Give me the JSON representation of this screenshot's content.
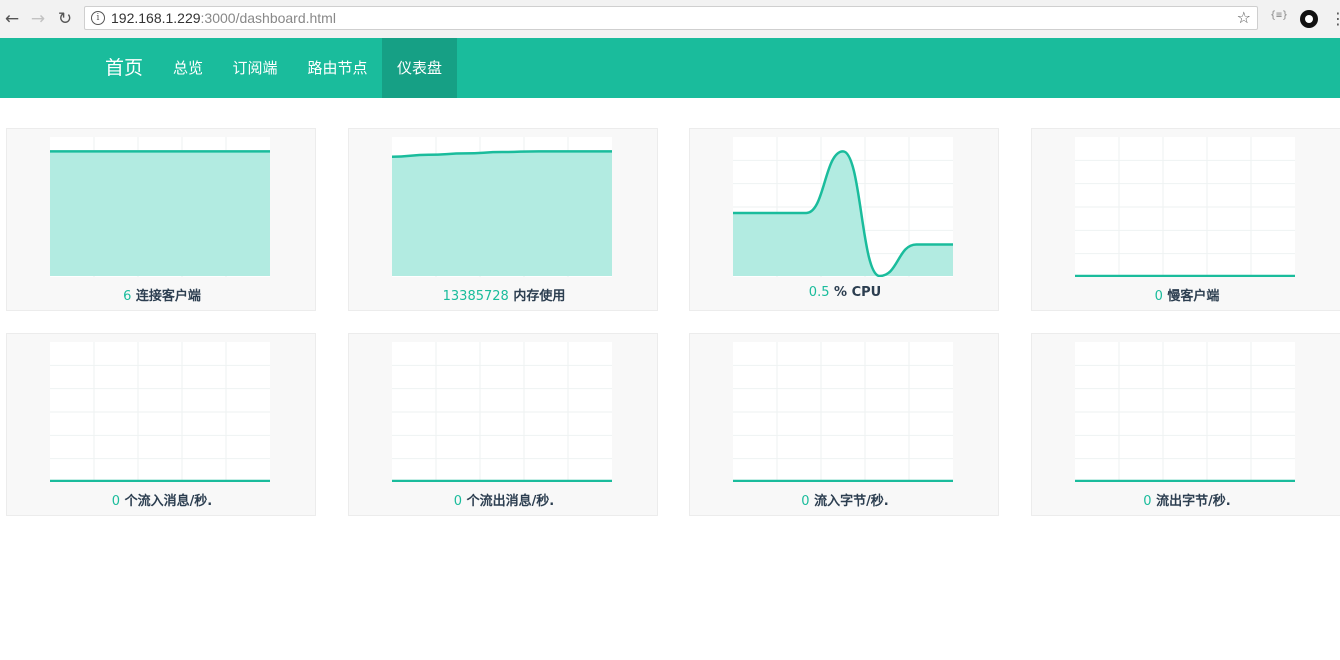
{
  "browser": {
    "url_host": "192.168.1.229",
    "url_rest": ":3000/dashboard.html"
  },
  "navbar": {
    "brand": "首页",
    "items": [
      {
        "label": "总览",
        "active": false
      },
      {
        "label": "订阅端",
        "active": false
      },
      {
        "label": "路由节点",
        "active": false
      },
      {
        "label": "仪表盘",
        "active": true
      }
    ]
  },
  "colors": {
    "accent": "#1abc9c",
    "accent_dark": "#16a085",
    "fill": "#b2ebe1",
    "label_text": "#2c3e50"
  },
  "cards": [
    {
      "value": "6",
      "label": "连接客户端"
    },
    {
      "value": "13385728",
      "label": "内存使用"
    },
    {
      "value": "0.5",
      "label": "% CPU"
    },
    {
      "value": "0",
      "label": "慢客户端"
    },
    {
      "value": "0",
      "label": "个流入消息/秒."
    },
    {
      "value": "0",
      "label": "个流出消息/秒."
    },
    {
      "value": "0",
      "label": "流入字节/秒."
    },
    {
      "value": "0",
      "label": "流出字节/秒."
    }
  ],
  "chart_data": [
    {
      "type": "area",
      "y": [
        0.91,
        0.91,
        0.91,
        0.91,
        0.91,
        0.91,
        0.91
      ]
    },
    {
      "type": "area",
      "y": [
        0.87,
        0.885,
        0.895,
        0.905,
        0.91,
        0.91,
        0.91
      ]
    },
    {
      "type": "area",
      "y": [
        0.46,
        0.46,
        0.46,
        0.91,
        0.0,
        0.23,
        0.23
      ]
    },
    {
      "type": "area",
      "y": [
        0,
        0,
        0,
        0,
        0,
        0,
        0
      ]
    },
    {
      "type": "area",
      "y": [
        0,
        0,
        0,
        0,
        0,
        0,
        0
      ]
    },
    {
      "type": "area",
      "y": [
        0,
        0,
        0,
        0,
        0,
        0,
        0
      ]
    },
    {
      "type": "area",
      "y": [
        0,
        0,
        0,
        0,
        0,
        0,
        0
      ]
    },
    {
      "type": "area",
      "y": [
        0,
        0,
        0,
        0,
        0,
        0,
        0
      ]
    }
  ]
}
